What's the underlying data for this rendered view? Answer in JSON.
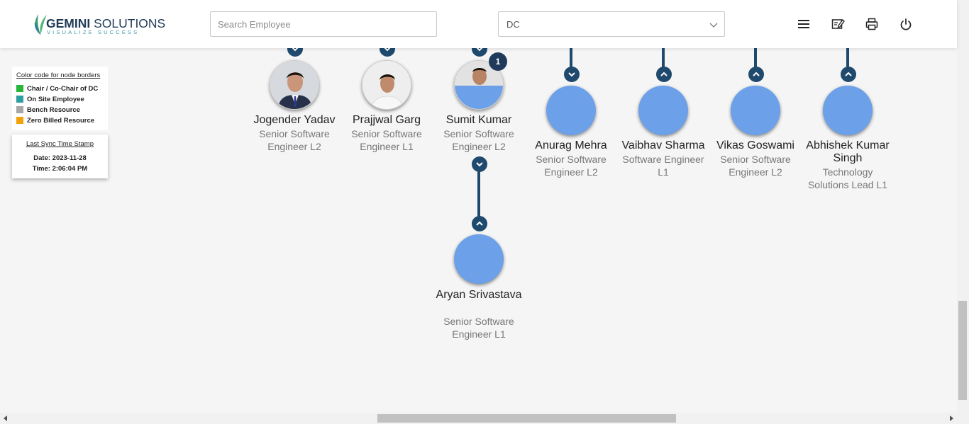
{
  "header": {
    "logo_main_bold": "GEMINI",
    "logo_main_light": " SOLUTIONS",
    "logo_tagline": "VISUALIZE SUCCESS",
    "search_placeholder": "Search Employee",
    "select_value": "DC",
    "icons": [
      "menu-icon",
      "edit-note-icon",
      "printer-icon",
      "power-icon"
    ]
  },
  "legend": {
    "title": "Color code for node borders",
    "items": [
      {
        "label": "Chair / Co-Chair of DC",
        "color": "#27b53a"
      },
      {
        "label": "On Site Employee",
        "color": "#2f9ea3"
      },
      {
        "label": "Bench Resource",
        "color": "#a6a6a6"
      },
      {
        "label": "Zero Billed Resource",
        "color": "#f2a20c"
      }
    ]
  },
  "sync": {
    "title": "Last Sync Time Stamp",
    "date": "Date: 2023-11-28",
    "time": "Time: 2:06:04 PM"
  },
  "nodes": [
    {
      "name": "Jogender Yadav",
      "title": "Senior Software Engineer L2",
      "avatar": "photo"
    },
    {
      "name": "Prajjwal Garg",
      "title": "Senior Software Engineer L1",
      "avatar": "photo"
    },
    {
      "name": "Sumit Kumar",
      "title": "Senior Software Engineer L2",
      "avatar": "photo",
      "badge": "1"
    },
    {
      "name": "Anurag Mehra",
      "title": "Senior Software Engineer L2",
      "avatar": "blank"
    },
    {
      "name": "Vaibhav Sharma",
      "title": "Software Engineer L1",
      "avatar": "blank"
    },
    {
      "name": "Vikas Goswami",
      "title": "Senior Software Engineer L2",
      "avatar": "blank"
    },
    {
      "name": "Abhishek Kumar Singh",
      "title": "Technology Solutions Lead L1",
      "avatar": "blank"
    },
    {
      "name": "Aryan Srivastava",
      "title": "Senior Software Engineer L1",
      "avatar": "blank"
    }
  ],
  "colors": {
    "connector": "#1f4a6e",
    "node_fill": "#6ca0e8",
    "badge": "#1f3a5a"
  }
}
